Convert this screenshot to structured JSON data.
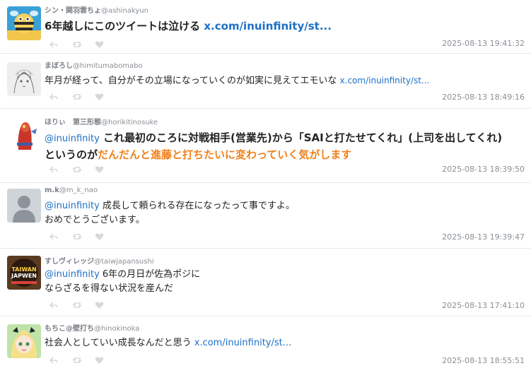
{
  "tweets": [
    {
      "display_name": "シン・関羽雲ちょ",
      "handle": "@ashinakyun",
      "text": "6年越しにこのツイートは泣ける ",
      "link": "x.com/inuinfinity/st...",
      "timestamp": "2025-08-13 19:41:32",
      "avatar": "cartoon-bee-avatar"
    },
    {
      "display_name": "まぼろし",
      "handle": "@himitumabomabo",
      "text": "年月が経って、自分がその立場になっていくのが如実に見えてエモいな ",
      "link": "x.com/inuinfinity/st...",
      "timestamp": "2025-08-13 18:49:16",
      "avatar": "sketch-avatar"
    },
    {
      "display_name": "ほりぃ　第三形態",
      "handle": "@horikitinosuke",
      "mention": "@inuinfinity",
      "text_part1": " これ最初のころに対戦相手(営業先)から「SAIと打たせてくれ」(上司を出してくれ)　というのが",
      "text_part2": "だんだんと進藤と打ちたいに変わっていく気がします",
      "timestamp": "2025-08-13 18:39:50",
      "avatar": "red-figure-avatar"
    },
    {
      "display_name": "m.k",
      "handle": "@m_k_nao",
      "mention": "@inuinfinity",
      "text_line1": " 成長して頼られる存在になったって事ですよ。",
      "text_line2": "おめでとうございます。",
      "timestamp": "2025-08-13 19:39:47",
      "avatar": "default-person-avatar"
    },
    {
      "display_name": "すしヴィレッジ",
      "handle": "@taiwjapansushi",
      "mention": "@inuinfinity",
      "text_line1": " 6年の月日が佐為ポジに",
      "text_line2": "ならざるを得ない状況を産んだ",
      "timestamp": "2025-08-13 17:41:10",
      "avatar": "taiwan-japan-logo-avatar",
      "avatar_text_1": "TAIWAN",
      "avatar_text_2": "JAPWEN"
    },
    {
      "display_name": "もちこ@壁打ち",
      "handle": "@hinokinoka",
      "text": "社会人としていい成長なんだと思う ",
      "link": "x.com/inuinfinity/st...",
      "timestamp": "2025-08-13 18:55:51",
      "avatar": "anime-girl-avatar"
    }
  ],
  "colors": {
    "link": "#1d6fc6",
    "highlight": "#f0801a",
    "meta": "#8a8f95",
    "divider": "#e4e8ec"
  }
}
